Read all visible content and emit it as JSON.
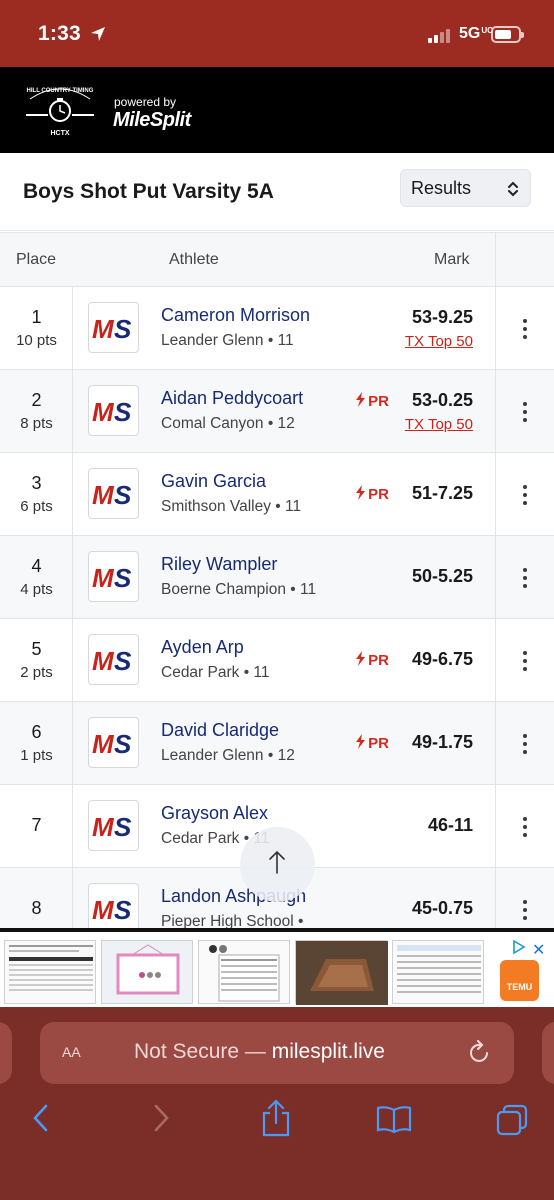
{
  "status_bar": {
    "time": "1:33",
    "network": "5G",
    "network_suffix": "UC"
  },
  "header": {
    "powered_by": "powered by",
    "brand": "MileSplit",
    "partner_logo_text": "HILL COUNTRY TIMING",
    "partner_logo_sub": "HCTX"
  },
  "page": {
    "title": "Boys Shot Put Varsity 5A",
    "view_select": "Results"
  },
  "table": {
    "columns": {
      "place": "Place",
      "athlete": "Athlete",
      "mark": "Mark"
    },
    "rows": [
      {
        "place": "1",
        "points": "10 pts",
        "name": "Cameron Morrison",
        "team": "Leander Glenn • 11",
        "pr": "",
        "mark": "53-9.25",
        "honor": "TX Top 50"
      },
      {
        "place": "2",
        "points": "8 pts",
        "name": "Aidan Peddycoart",
        "team": "Comal Canyon • 12",
        "pr": "PR",
        "mark": "53-0.25",
        "honor": "TX Top 50"
      },
      {
        "place": "3",
        "points": "6 pts",
        "name": "Gavin Garcia",
        "team": "Smithson Valley • 11",
        "pr": "PR",
        "mark": "51-7.25",
        "honor": ""
      },
      {
        "place": "4",
        "points": "4 pts",
        "name": "Riley Wampler",
        "team": "Boerne Champion • 11",
        "pr": "",
        "mark": "50-5.25",
        "honor": ""
      },
      {
        "place": "5",
        "points": "2 pts",
        "name": "Ayden Arp",
        "team": "Cedar Park • 11",
        "pr": "PR",
        "mark": "49-6.75",
        "honor": ""
      },
      {
        "place": "6",
        "points": "1 pts",
        "name": "David Claridge",
        "team": "Leander Glenn • 12",
        "pr": "PR",
        "mark": "49-1.75",
        "honor": ""
      },
      {
        "place": "7",
        "points": "",
        "name": "Grayson Alex",
        "team": "Cedar Park • 11",
        "pr": "",
        "mark": "46-11",
        "honor": ""
      },
      {
        "place": "8",
        "points": "",
        "name": "Landon Ashpaugh",
        "team": "Pieper High School •",
        "pr": "",
        "mark": "45-0.75",
        "honor": ""
      }
    ]
  },
  "ad": {
    "brand": "TEMU"
  },
  "browser": {
    "text_size": "AA",
    "security": "Not Secure — ",
    "domain": "milesplit.live"
  },
  "colors": {
    "status_bar": "#9c2c22",
    "safari_bar": "#7b2d27",
    "link_navy": "#172a75",
    "pr_red": "#d42a1f"
  },
  "icons": [
    "location-arrow-icon",
    "signal-icon",
    "battery-icon",
    "chevron-updown-icon",
    "lightning-icon",
    "kebab-menu-icon",
    "arrow-up-icon",
    "refresh-icon",
    "back-icon",
    "forward-icon",
    "share-icon",
    "bookmarks-icon",
    "tabs-icon",
    "adchoices-icon",
    "close-icon"
  ]
}
